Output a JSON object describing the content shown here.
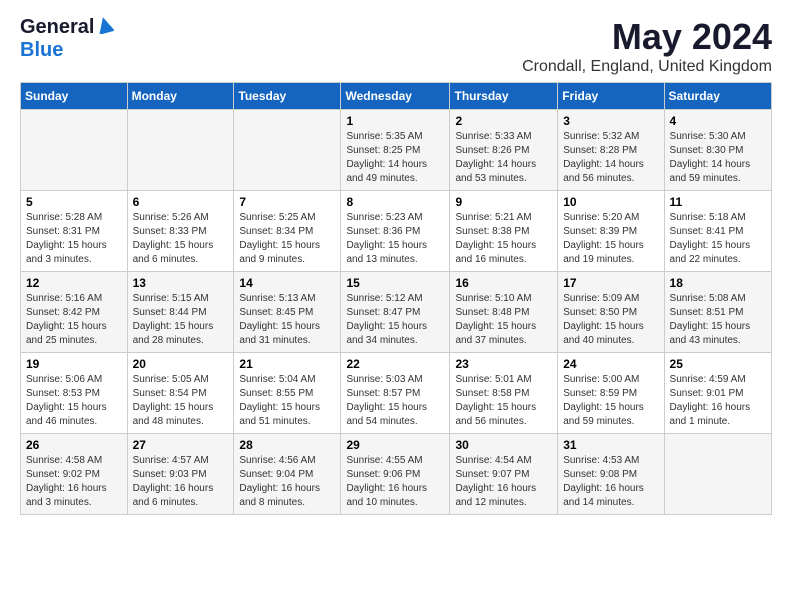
{
  "logo": {
    "general": "General",
    "blue": "Blue"
  },
  "title": "May 2024",
  "subtitle": "Crondall, England, United Kingdom",
  "days_of_week": [
    "Sunday",
    "Monday",
    "Tuesday",
    "Wednesday",
    "Thursday",
    "Friday",
    "Saturday"
  ],
  "weeks": [
    [
      {
        "day": "",
        "info": ""
      },
      {
        "day": "",
        "info": ""
      },
      {
        "day": "",
        "info": ""
      },
      {
        "day": "1",
        "info": "Sunrise: 5:35 AM\nSunset: 8:25 PM\nDaylight: 14 hours\nand 49 minutes."
      },
      {
        "day": "2",
        "info": "Sunrise: 5:33 AM\nSunset: 8:26 PM\nDaylight: 14 hours\nand 53 minutes."
      },
      {
        "day": "3",
        "info": "Sunrise: 5:32 AM\nSunset: 8:28 PM\nDaylight: 14 hours\nand 56 minutes."
      },
      {
        "day": "4",
        "info": "Sunrise: 5:30 AM\nSunset: 8:30 PM\nDaylight: 14 hours\nand 59 minutes."
      }
    ],
    [
      {
        "day": "5",
        "info": "Sunrise: 5:28 AM\nSunset: 8:31 PM\nDaylight: 15 hours\nand 3 minutes."
      },
      {
        "day": "6",
        "info": "Sunrise: 5:26 AM\nSunset: 8:33 PM\nDaylight: 15 hours\nand 6 minutes."
      },
      {
        "day": "7",
        "info": "Sunrise: 5:25 AM\nSunset: 8:34 PM\nDaylight: 15 hours\nand 9 minutes."
      },
      {
        "day": "8",
        "info": "Sunrise: 5:23 AM\nSunset: 8:36 PM\nDaylight: 15 hours\nand 13 minutes."
      },
      {
        "day": "9",
        "info": "Sunrise: 5:21 AM\nSunset: 8:38 PM\nDaylight: 15 hours\nand 16 minutes."
      },
      {
        "day": "10",
        "info": "Sunrise: 5:20 AM\nSunset: 8:39 PM\nDaylight: 15 hours\nand 19 minutes."
      },
      {
        "day": "11",
        "info": "Sunrise: 5:18 AM\nSunset: 8:41 PM\nDaylight: 15 hours\nand 22 minutes."
      }
    ],
    [
      {
        "day": "12",
        "info": "Sunrise: 5:16 AM\nSunset: 8:42 PM\nDaylight: 15 hours\nand 25 minutes."
      },
      {
        "day": "13",
        "info": "Sunrise: 5:15 AM\nSunset: 8:44 PM\nDaylight: 15 hours\nand 28 minutes."
      },
      {
        "day": "14",
        "info": "Sunrise: 5:13 AM\nSunset: 8:45 PM\nDaylight: 15 hours\nand 31 minutes."
      },
      {
        "day": "15",
        "info": "Sunrise: 5:12 AM\nSunset: 8:47 PM\nDaylight: 15 hours\nand 34 minutes."
      },
      {
        "day": "16",
        "info": "Sunrise: 5:10 AM\nSunset: 8:48 PM\nDaylight: 15 hours\nand 37 minutes."
      },
      {
        "day": "17",
        "info": "Sunrise: 5:09 AM\nSunset: 8:50 PM\nDaylight: 15 hours\nand 40 minutes."
      },
      {
        "day": "18",
        "info": "Sunrise: 5:08 AM\nSunset: 8:51 PM\nDaylight: 15 hours\nand 43 minutes."
      }
    ],
    [
      {
        "day": "19",
        "info": "Sunrise: 5:06 AM\nSunset: 8:53 PM\nDaylight: 15 hours\nand 46 minutes."
      },
      {
        "day": "20",
        "info": "Sunrise: 5:05 AM\nSunset: 8:54 PM\nDaylight: 15 hours\nand 48 minutes."
      },
      {
        "day": "21",
        "info": "Sunrise: 5:04 AM\nSunset: 8:55 PM\nDaylight: 15 hours\nand 51 minutes."
      },
      {
        "day": "22",
        "info": "Sunrise: 5:03 AM\nSunset: 8:57 PM\nDaylight: 15 hours\nand 54 minutes."
      },
      {
        "day": "23",
        "info": "Sunrise: 5:01 AM\nSunset: 8:58 PM\nDaylight: 15 hours\nand 56 minutes."
      },
      {
        "day": "24",
        "info": "Sunrise: 5:00 AM\nSunset: 8:59 PM\nDaylight: 15 hours\nand 59 minutes."
      },
      {
        "day": "25",
        "info": "Sunrise: 4:59 AM\nSunset: 9:01 PM\nDaylight: 16 hours\nand 1 minute."
      }
    ],
    [
      {
        "day": "26",
        "info": "Sunrise: 4:58 AM\nSunset: 9:02 PM\nDaylight: 16 hours\nand 3 minutes."
      },
      {
        "day": "27",
        "info": "Sunrise: 4:57 AM\nSunset: 9:03 PM\nDaylight: 16 hours\nand 6 minutes."
      },
      {
        "day": "28",
        "info": "Sunrise: 4:56 AM\nSunset: 9:04 PM\nDaylight: 16 hours\nand 8 minutes."
      },
      {
        "day": "29",
        "info": "Sunrise: 4:55 AM\nSunset: 9:06 PM\nDaylight: 16 hours\nand 10 minutes."
      },
      {
        "day": "30",
        "info": "Sunrise: 4:54 AM\nSunset: 9:07 PM\nDaylight: 16 hours\nand 12 minutes."
      },
      {
        "day": "31",
        "info": "Sunrise: 4:53 AM\nSunset: 9:08 PM\nDaylight: 16 hours\nand 14 minutes."
      },
      {
        "day": "",
        "info": ""
      }
    ]
  ]
}
